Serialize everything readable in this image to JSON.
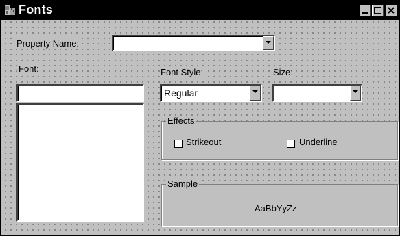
{
  "window": {
    "title": "Fonts",
    "icon": "app-icon"
  },
  "titlebar_buttons": {
    "minimize": "minimize-icon",
    "maximize": "maximize-icon",
    "close": "close-icon"
  },
  "property_name": {
    "label": "Property Name:",
    "value": ""
  },
  "font": {
    "label": "Font:",
    "value": "",
    "list_items": []
  },
  "font_style": {
    "label": "Font Style:",
    "value": "Regular"
  },
  "size": {
    "label": "Size:",
    "value": ""
  },
  "effects": {
    "label": "Effects",
    "strikeout": {
      "label": "Strikeout",
      "checked": false
    },
    "underline": {
      "label": "Underline",
      "checked": false
    }
  },
  "sample": {
    "label": "Sample",
    "text": "AaBbYyZz"
  }
}
